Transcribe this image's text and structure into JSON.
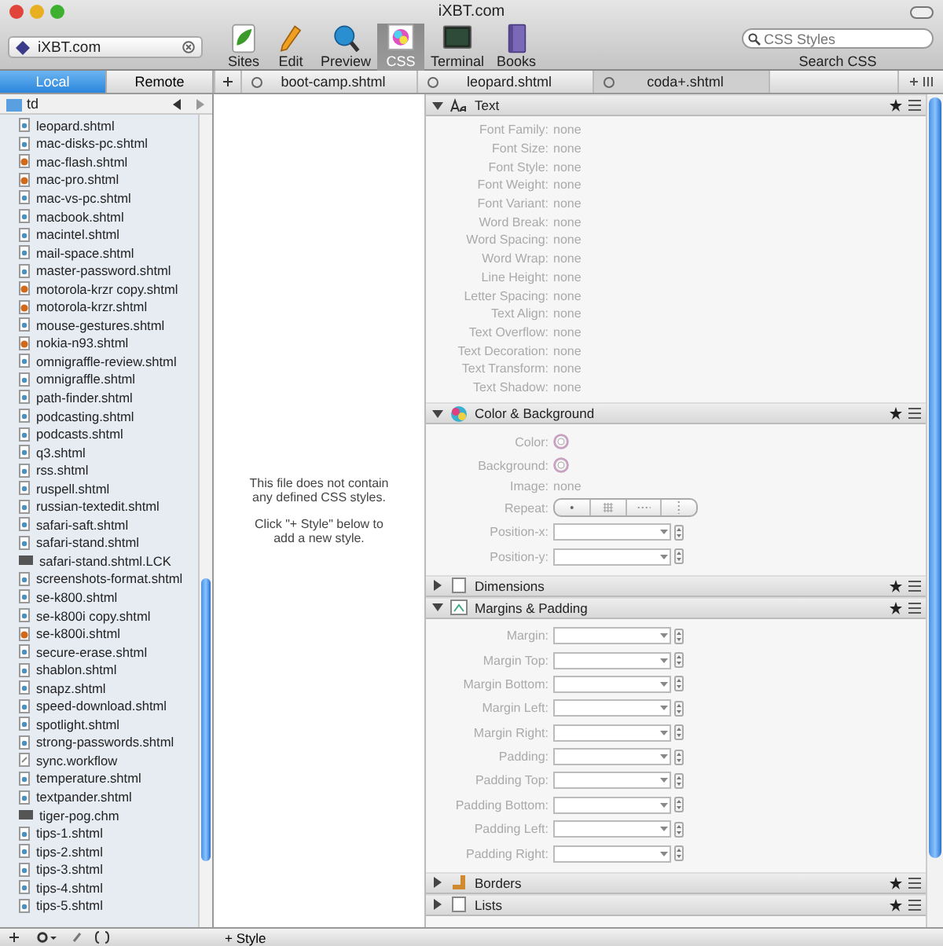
{
  "window": {
    "title": "iXBT.com"
  },
  "site_selector": {
    "value": "iXBT.com"
  },
  "toolbar": [
    {
      "label": "Sites",
      "selected": false
    },
    {
      "label": "Edit",
      "selected": false
    },
    {
      "label": "Preview",
      "selected": false
    },
    {
      "label": "CSS",
      "selected": true
    },
    {
      "label": "Terminal",
      "selected": false
    },
    {
      "label": "Books",
      "selected": false
    }
  ],
  "search": {
    "placeholder": "CSS Styles",
    "label": "Search CSS"
  },
  "sidebar": {
    "tabs": [
      {
        "label": "Local",
        "selected": true
      },
      {
        "label": "Remote",
        "selected": false
      }
    ],
    "folder": "td",
    "files": [
      {
        "name": "leopard.shtml",
        "kind": "html"
      },
      {
        "name": "mac-disks-pc.shtml",
        "kind": "html"
      },
      {
        "name": "mac-flash.shtml",
        "kind": "modified"
      },
      {
        "name": "mac-pro.shtml",
        "kind": "modified"
      },
      {
        "name": "mac-vs-pc.shtml",
        "kind": "html"
      },
      {
        "name": "macbook.shtml",
        "kind": "html"
      },
      {
        "name": "macintel.shtml",
        "kind": "html"
      },
      {
        "name": "mail-space.shtml",
        "kind": "html"
      },
      {
        "name": "master-password.shtml",
        "kind": "html"
      },
      {
        "name": "motorola-krzr copy.shtml",
        "kind": "modified"
      },
      {
        "name": "motorola-krzr.shtml",
        "kind": "modified"
      },
      {
        "name": "mouse-gestures.shtml",
        "kind": "html"
      },
      {
        "name": "nokia-n93.shtml",
        "kind": "modified"
      },
      {
        "name": "omnigraffle-review.shtml",
        "kind": "html"
      },
      {
        "name": "omnigraffle.shtml",
        "kind": "html"
      },
      {
        "name": "path-finder.shtml",
        "kind": "html"
      },
      {
        "name": "podcasting.shtml",
        "kind": "html"
      },
      {
        "name": "podcasts.shtml",
        "kind": "html"
      },
      {
        "name": "q3.shtml",
        "kind": "html"
      },
      {
        "name": "rss.shtml",
        "kind": "html"
      },
      {
        "name": "ruspell.shtml",
        "kind": "html"
      },
      {
        "name": "russian-textedit.shtml",
        "kind": "html"
      },
      {
        "name": "safari-saft.shtml",
        "kind": "html"
      },
      {
        "name": "safari-stand.shtml",
        "kind": "html"
      },
      {
        "name": "safari-stand.shtml.LCK",
        "kind": "binary"
      },
      {
        "name": "screenshots-format.shtml",
        "kind": "html"
      },
      {
        "name": "se-k800.shtml",
        "kind": "html"
      },
      {
        "name": "se-k800i copy.shtml",
        "kind": "html"
      },
      {
        "name": "se-k800i.shtml",
        "kind": "modified"
      },
      {
        "name": "secure-erase.shtml",
        "kind": "html"
      },
      {
        "name": "shablon.shtml",
        "kind": "html"
      },
      {
        "name": "snapz.shtml",
        "kind": "html"
      },
      {
        "name": "speed-download.shtml",
        "kind": "html"
      },
      {
        "name": "spotlight.shtml",
        "kind": "html"
      },
      {
        "name": "strong-passwords.shtml",
        "kind": "html"
      },
      {
        "name": "sync.workflow",
        "kind": "plain"
      },
      {
        "name": "temperature.shtml",
        "kind": "html"
      },
      {
        "name": "textpander.shtml",
        "kind": "html"
      },
      {
        "name": "tiger-pog.chm",
        "kind": "binary"
      },
      {
        "name": "tips-1.shtml",
        "kind": "html"
      },
      {
        "name": "tips-2.shtml",
        "kind": "html"
      },
      {
        "name": "tips-3.shtml",
        "kind": "html"
      },
      {
        "name": "tips-4.shtml",
        "kind": "html"
      },
      {
        "name": "tips-5.shtml",
        "kind": "html"
      }
    ]
  },
  "document_tabs": [
    {
      "label": "boot-camp.shtml",
      "selected": false
    },
    {
      "label": "leopard.shtml",
      "selected": false
    },
    {
      "label": "coda+.shtml",
      "selected": true
    }
  ],
  "editor": {
    "message": "This file does not contain any defined CSS styles.",
    "hint": "Click \"+ Style\" below to add a new style."
  },
  "bottom_bar": {
    "style_button": "+ Style"
  },
  "css_sections": [
    {
      "title": "Text",
      "expanded": true,
      "properties": [
        {
          "label": "Font Family:",
          "kind": "text",
          "value": "none"
        },
        {
          "label": "Font Size:",
          "kind": "text",
          "value": "none"
        },
        {
          "label": "Font Style:",
          "kind": "text",
          "value": "none"
        },
        {
          "label": "Font Weight:",
          "kind": "text",
          "value": "none"
        },
        {
          "label": "Font Variant:",
          "kind": "text",
          "value": "none"
        },
        {
          "label": "Word Break:",
          "kind": "text",
          "value": "none"
        },
        {
          "label": "Word Spacing:",
          "kind": "text",
          "value": "none"
        },
        {
          "label": "Word Wrap:",
          "kind": "text",
          "value": "none"
        },
        {
          "label": "Line Height:",
          "kind": "text",
          "value": "none"
        },
        {
          "label": "Letter Spacing:",
          "kind": "text",
          "value": "none"
        },
        {
          "label": "Text Align:",
          "kind": "text",
          "value": "none"
        },
        {
          "label": "Text Overflow:",
          "kind": "text",
          "value": "none"
        },
        {
          "label": "Text Decoration:",
          "kind": "text",
          "value": "none"
        },
        {
          "label": "Text Transform:",
          "kind": "text",
          "value": "none"
        },
        {
          "label": "Text Shadow:",
          "kind": "text",
          "value": "none"
        }
      ]
    },
    {
      "title": "Color & Background",
      "expanded": true,
      "properties": [
        {
          "label": "Color:",
          "kind": "color"
        },
        {
          "label": "Background:",
          "kind": "color"
        },
        {
          "label": "Image:",
          "kind": "text",
          "value": "none"
        },
        {
          "label": "Repeat:",
          "kind": "segmented"
        },
        {
          "label": "Position-x:",
          "kind": "combo"
        },
        {
          "label": "Position-y:",
          "kind": "combo"
        }
      ]
    },
    {
      "title": "Dimensions",
      "expanded": false
    },
    {
      "title": "Margins & Padding",
      "expanded": true,
      "properties": [
        {
          "label": "Margin:",
          "kind": "combo"
        },
        {
          "label": "Margin Top:",
          "kind": "combo"
        },
        {
          "label": "Margin Bottom:",
          "kind": "combo"
        },
        {
          "label": "Margin Left:",
          "kind": "combo"
        },
        {
          "label": "Margin Right:",
          "kind": "combo"
        },
        {
          "label": "Padding:",
          "kind": "combo"
        },
        {
          "label": "Padding Top:",
          "kind": "combo"
        },
        {
          "label": "Padding Bottom:",
          "kind": "combo"
        },
        {
          "label": "Padding Left:",
          "kind": "combo"
        },
        {
          "label": "Padding Right:",
          "kind": "combo"
        }
      ]
    },
    {
      "title": "Borders",
      "expanded": false
    },
    {
      "title": "Lists",
      "expanded": false
    }
  ]
}
